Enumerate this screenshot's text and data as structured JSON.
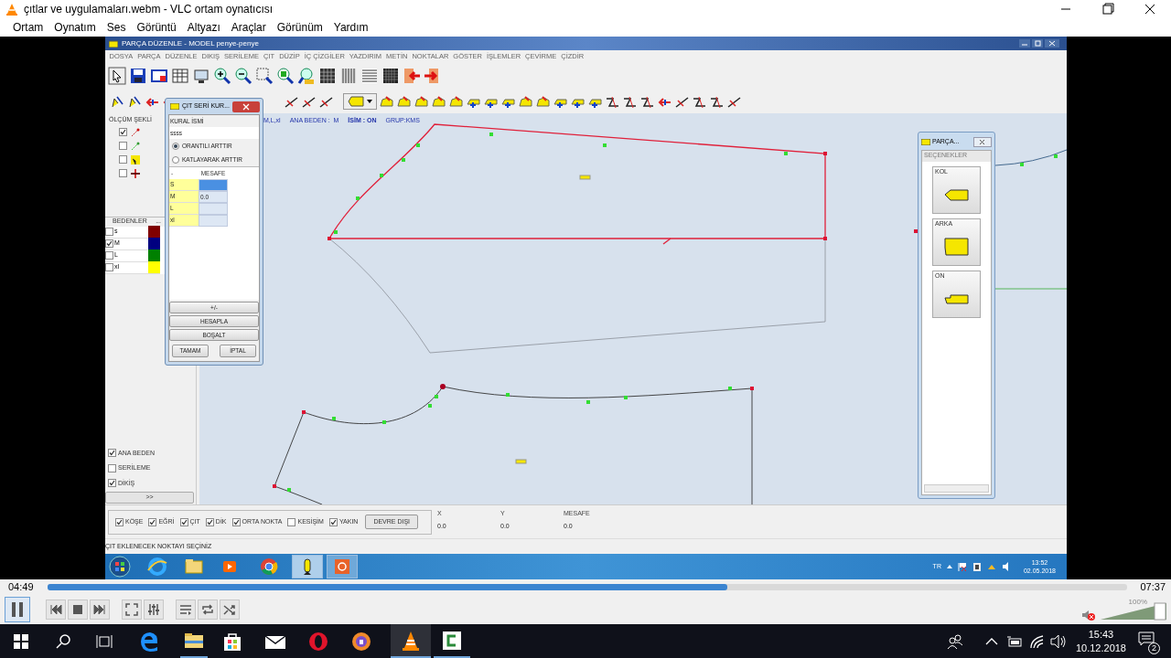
{
  "window": {
    "title": "çıtlar ve uygulamaları.webm - VLC ortam oynatıcısı"
  },
  "menu": [
    "Ortam",
    "Oynatım",
    "Ses",
    "Görüntü",
    "Altyazı",
    "Araçlar",
    "Görünüm",
    "Yardım"
  ],
  "video": {
    "app_title": "PARÇA DÜZENLE - MODEL penye-penye",
    "app_menu": [
      "DOSYA",
      "PARÇA",
      "DÜZENLE",
      "DIKIŞ",
      "SERİLEME",
      "ÇIT",
      "DÜZİP",
      "İÇ ÇİZGİLER",
      "YAZDIRIM",
      "METİN",
      "NOKTALAR",
      "GÖSTER",
      "İŞLEMLER",
      "ÇEVİRME",
      "ÇİZDİR"
    ],
    "info": [
      "M,L,xl",
      "ANA BEDEN :  M",
      "İSİM : ON",
      "GRUP:KMS"
    ],
    "measure_panel": {
      "title": "ÖLÇÜM ŞEKLİ",
      "options": [
        {
          "checked": true
        },
        {
          "checked": false
        },
        {
          "checked": false
        },
        {
          "checked": false
        }
      ]
    },
    "sizes": {
      "header": "BEDENLER",
      "more": "...",
      "rows": [
        {
          "label": "s",
          "checked": false,
          "color": "#800000"
        },
        {
          "label": "M",
          "checked": true,
          "color": "#000080"
        },
        {
          "label": "L",
          "checked": false,
          "color": "#008000"
        },
        {
          "label": "xl",
          "checked": false,
          "color": "#ffff00"
        }
      ]
    },
    "options": [
      {
        "label": "ANA BEDEN",
        "checked": true
      },
      {
        "label": "SERİLEME",
        "checked": false
      },
      {
        "label": "DİKİŞ",
        "checked": true
      }
    ],
    "expand_button": ">>",
    "dialog": {
      "title": "ÇIT SERİ KUR...",
      "field_label": "KURAL İSMİ",
      "field_value": "ssss",
      "radios": [
        {
          "label": "ORANTILI ARTTIR",
          "selected": true
        },
        {
          "label": "KATLAYARAK ARTTIR",
          "selected": false
        }
      ],
      "table": {
        "corner": "-",
        "column": "MESAFE",
        "rows": [
          {
            "size": "S",
            "selected": true
          },
          {
            "size": "M",
            "value": "0.0",
            "selected": false
          },
          {
            "size": "L",
            "selected": false
          },
          {
            "size": "xl",
            "selected": false
          }
        ]
      },
      "buttons": [
        "+/-",
        "HESAPLA",
        "BOŞALT"
      ],
      "footer_buttons": [
        "TAMAM",
        "İPTAL"
      ]
    },
    "parts_panel": {
      "title": "PARÇA...",
      "section": "SEÇENEKLER",
      "items": [
        "KOL",
        "ARKA",
        "ON"
      ]
    },
    "snaps": [
      {
        "label": "KÖŞE",
        "checked": true
      },
      {
        "label": "EĞRİ",
        "checked": true
      },
      {
        "label": "ÇIT",
        "checked": true
      },
      {
        "label": "DİK",
        "checked": true
      },
      {
        "label": "ORTA NOKTA",
        "checked": true
      },
      {
        "label": "KESİŞİM",
        "checked": false
      },
      {
        "label": "YAKIN",
        "checked": true
      }
    ],
    "disable_button": "DEVRE DIŞI",
    "coords": [
      {
        "label": "X",
        "value": "0.0"
      },
      {
        "label": "Y",
        "value": "0.0"
      },
      {
        "label": "MESAFE",
        "value": "0.0"
      }
    ],
    "status": "ÇIT EKLENECEK NOKTAYI SEÇİNİZ",
    "taskbar": {
      "lang": "TR",
      "time": "13:52",
      "date": "02.05.2018"
    }
  },
  "player": {
    "elapsed": "04:49",
    "total": "07:37",
    "level": 0.63,
    "muted": true,
    "volume": {
      "reading": "100%",
      "level": 1.0
    }
  },
  "taskbar": {
    "time": "15:43",
    "date": "10.12.2018",
    "notifications": "2"
  }
}
